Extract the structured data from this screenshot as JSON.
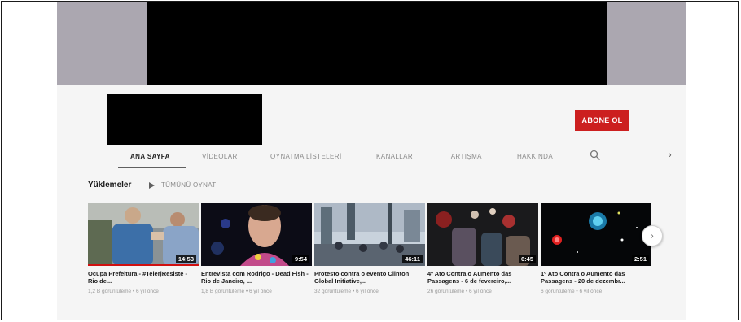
{
  "channel": {
    "subscribe_label": "ABONE OL"
  },
  "tabs": [
    {
      "label": "ANA SAYFA",
      "active": true
    },
    {
      "label": "VİDEOLAR"
    },
    {
      "label": "OYNATMA LİSTELERİ"
    },
    {
      "label": "KANALLAR"
    },
    {
      "label": "TARTIŞMA"
    },
    {
      "label": "HAKKINDA"
    }
  ],
  "icons": {
    "search": "search-icon",
    "tabs_next": "chevron-right-icon",
    "play_all": "play-icon",
    "carousel_next": "chevron-right-icon"
  },
  "colors": {
    "subscribe": "#cc1f1f",
    "progress": "#d01010",
    "banner": "#aba7b0"
  },
  "uploads": {
    "title": "Yüklemeler",
    "play_all": "TÜMÜNÜ OYNAT",
    "next_arrow": "›",
    "videos": [
      {
        "title": "Ocupa Prefeitura - #TelerjResiste - Rio de...",
        "meta": "1,2 B görüntüleme • 6 yıl önce",
        "duration": "14:53",
        "progress": 1.0
      },
      {
        "title": "Entrevista com Rodrigo - Dead Fish - Rio de Janeiro, ...",
        "meta": "1,8 B görüntüleme • 6 yıl önce",
        "duration": "9:54"
      },
      {
        "title": "Protesto contra o evento Clinton Global Initiative,...",
        "meta": "32 görüntüleme • 6 yıl önce",
        "duration": "46:11"
      },
      {
        "title": "4º Ato Contra o Aumento das Passagens - 6 de fevereiro,...",
        "meta": "26 görüntüleme • 6 yıl önce",
        "duration": "6:45"
      },
      {
        "title": "1º Ato Contra o Aumento das Passagens - 20 de dezembr...",
        "meta": "6 görüntüleme • 6 yıl önce",
        "duration": "2:51"
      }
    ]
  }
}
